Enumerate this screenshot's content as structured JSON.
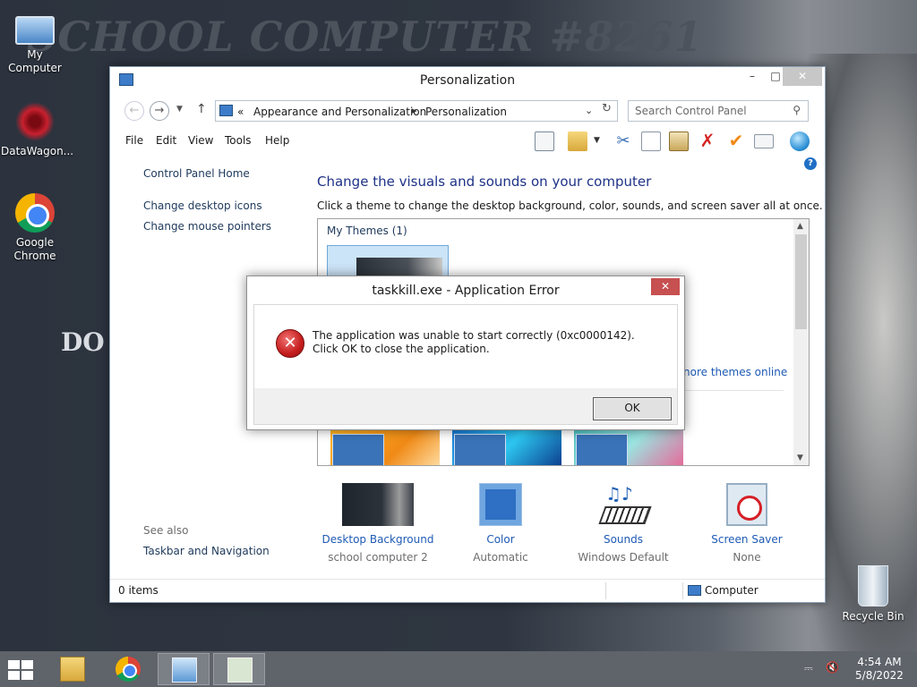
{
  "wallpaper": {
    "title_text": "SCHOOL COMPUTER #8261",
    "side_text": "DO"
  },
  "desktop_icons": [
    {
      "label": "My Computer",
      "icon": "computer-icon"
    },
    {
      "label": "DataWagon...",
      "icon": "datawagon-icon"
    },
    {
      "label": "Google Chrome",
      "icon": "chrome-icon"
    },
    {
      "label": "Recycle Bin",
      "icon": "recycle-bin-icon"
    }
  ],
  "window": {
    "title": "Personalization",
    "controls": {
      "minimize": "–",
      "maximize": "□",
      "close": "✕"
    },
    "breadcrumb": {
      "prefix": "«",
      "items": [
        "Appearance and Personalization",
        "Personalization"
      ]
    },
    "search_placeholder": "Search Control Panel",
    "menu": [
      "File",
      "Edit",
      "View",
      "Tools",
      "Help"
    ],
    "left_pane": {
      "home": "Control Panel Home",
      "links": [
        "Change desktop icons",
        "Change mouse pointers"
      ],
      "see_also_label": "See also",
      "see_also_links": [
        "Taskbar and Navigation"
      ]
    },
    "main": {
      "heading": "Change the visuals and sounds on your computer",
      "subheading": "Click a theme to change the desktop background, color, sounds, and screen saver all at once.",
      "my_themes_label": "My Themes (1)",
      "more_themes_link": "nore themes online"
    },
    "bottom_items": [
      {
        "label": "Desktop Background",
        "value": "school computer 2"
      },
      {
        "label": "Color",
        "value": "Automatic"
      },
      {
        "label": "Sounds",
        "value": "Windows Default"
      },
      {
        "label": "Screen Saver",
        "value": "None"
      }
    ],
    "status": {
      "items": "0 items",
      "location": "Computer"
    }
  },
  "dialog": {
    "title": "taskkill.exe - Application Error",
    "close": "✕",
    "message": "The application was unable to start correctly (0xc0000142). Click OK to close the application.",
    "ok_label": "OK"
  },
  "taskbar": {
    "apps": [
      "file-explorer-icon",
      "chrome-icon",
      "control-panel-icon",
      "window-icon"
    ],
    "time": "4:54 AM",
    "date": "5/8/2022"
  },
  "colors": {
    "accent": "#1e3287",
    "link": "#1e5ab5",
    "error_red": "#c51d1d",
    "taskbar": "#5f636a"
  }
}
